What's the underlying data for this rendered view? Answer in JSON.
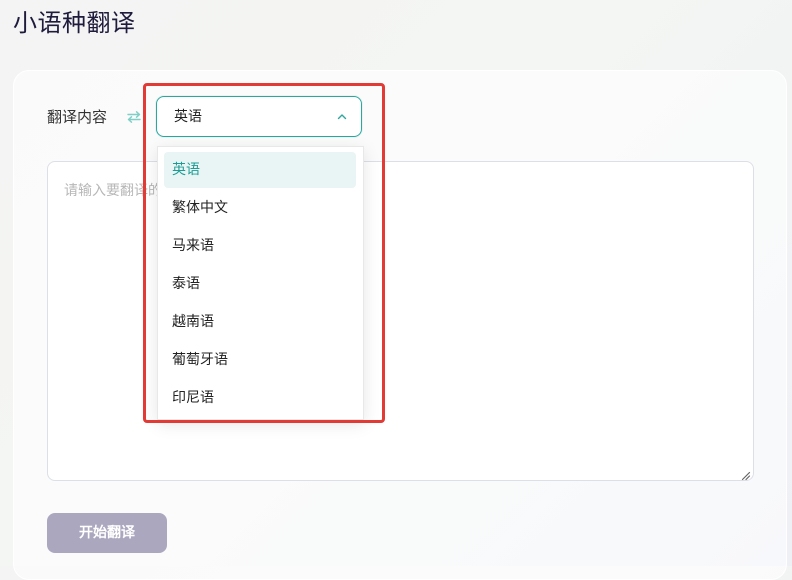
{
  "page": {
    "title": "小语种翻译"
  },
  "form": {
    "label": "翻译内容",
    "swap_icon": "swap-icon",
    "selected_language": "英语",
    "textarea_placeholder": "请输入要翻译的内容",
    "start_button": "开始翻译"
  },
  "dropdown": {
    "items": [
      {
        "label": "英语",
        "selected": true
      },
      {
        "label": "繁体中文",
        "selected": false
      },
      {
        "label": "马来语",
        "selected": false
      },
      {
        "label": "泰语",
        "selected": false
      },
      {
        "label": "越南语",
        "selected": false
      },
      {
        "label": "葡萄牙语",
        "selected": false
      },
      {
        "label": "印尼语",
        "selected": false
      }
    ]
  },
  "colors": {
    "accent": "#2ba7a0",
    "selected_item_bg": "#e8f5f4",
    "button_bg": "#aaa7bf",
    "highlight_box": "#e23a34"
  }
}
